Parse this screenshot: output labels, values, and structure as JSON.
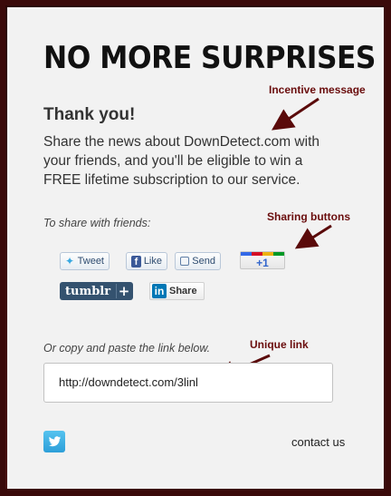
{
  "header": {
    "title": "NO MORE SURPRISES"
  },
  "message": {
    "heading": "Thank you!",
    "body": "Share the news about DownDetect.com with your friends, and you'll be eligible to win a FREE lifetime subscription to our service."
  },
  "annotations": {
    "incentive": "Incentive message",
    "sharing": "Sharing buttons",
    "unique_link": "Unique link"
  },
  "share": {
    "label": "To share with friends:",
    "tweet": "Tweet",
    "like": "Like",
    "send": "Send",
    "gplus": "+1",
    "tumblr": "tumblr",
    "tumblr_plus": "+",
    "linkedin_logo": "in",
    "linkedin": "Share"
  },
  "copy": {
    "label": "Or copy and paste the link below.",
    "url": "http://downdetect.com/3linl"
  },
  "footer": {
    "contact": "contact us"
  },
  "colors": {
    "annotation": "#6a0d0d",
    "tumblr": "#34526f",
    "twitter": "#37a7e0",
    "facebook": "#3b5998",
    "linkedin": "#0077b5"
  }
}
